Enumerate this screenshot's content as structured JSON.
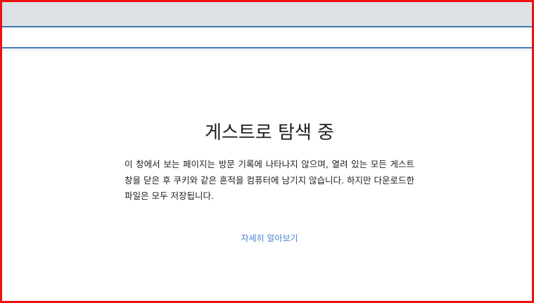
{
  "browser": {
    "tabstrip_color": "#dee1e6",
    "toolbar_border_color": "#3a78b5",
    "address_value": ""
  },
  "guest": {
    "title": "게스트로 탐색 중",
    "description": "이 창에서 보는 페이지는 방문 기록에 나타나지 않으며, 열려 있는 모든 게스트 창을 닫은 후 쿠키와 같은 흔적을 컴퓨터에 남기지 않습니다. 하지만 다운로드한 파일은 모두 저장됩니다.",
    "learn_more_label": "자세히 알아보기",
    "link_color": "#4a7fd1"
  }
}
